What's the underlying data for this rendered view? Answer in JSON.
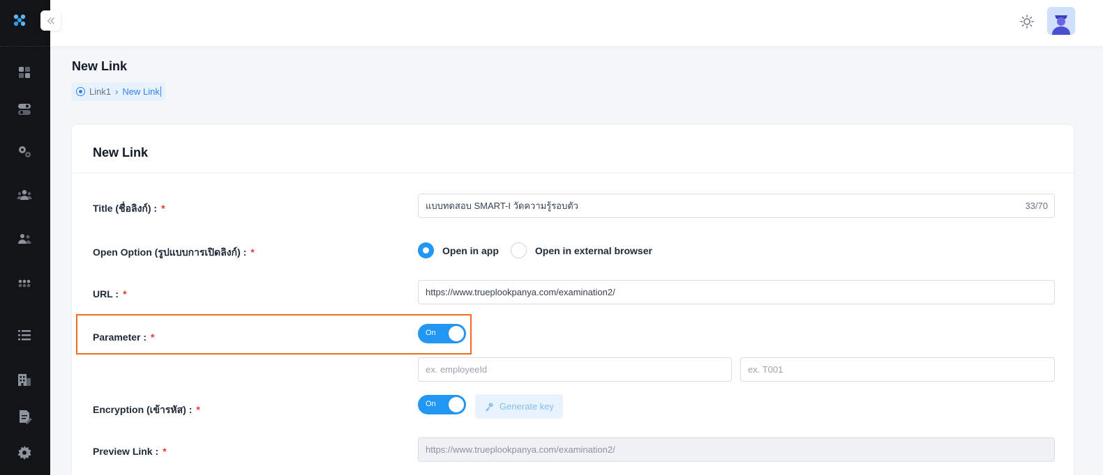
{
  "sidebar": {
    "logo": "app-logo",
    "icons": [
      "dashboard-icon",
      "toggle-settings-icon",
      "gears-icon",
      "users-icon",
      "user-group-icon",
      "apps-grid-icon",
      "list-icon",
      "building-icon",
      "document-edit-icon",
      "settings-gear-icon"
    ]
  },
  "topbar": {
    "theme_icon": "sun-icon",
    "avatar": "user-avatar"
  },
  "page": {
    "title": "New Link",
    "breadcrumb": {
      "parent": "Link1",
      "current": "New Link"
    }
  },
  "form": {
    "card_title": "New Link",
    "title_label": "Title (ชื่อลิงก์) :",
    "title_value": "แบบทดสอบ SMART-I วัดความรู้รอบตัว",
    "title_counter": "33/70",
    "open_option_label": "Open Option (รูปแบบการเปิดลิงก์) :",
    "open_in_app": "Open in app",
    "open_in_external": "Open in external browser",
    "selected_open_option": "Open in app",
    "url_label": "URL :",
    "url_value": "https://www.trueplookpanya.com/examination2/",
    "parameter_label": "Parameter :",
    "parameter_toggle": "On",
    "param_key_placeholder": "ex. employeeId",
    "param_value_placeholder": "ex. T001",
    "encryption_label": "Encryption (เข้ารหัส) :",
    "encryption_toggle": "On",
    "generate_key": "Generate key",
    "preview_label": "Preview Link :",
    "preview_value": "https://www.trueplookpanya.com/examination2/",
    "required_mark": "*"
  },
  "colors": {
    "accent": "#2196f3",
    "highlight": "#f26a1b",
    "required": "#e53935",
    "sidebar": "#121418"
  }
}
